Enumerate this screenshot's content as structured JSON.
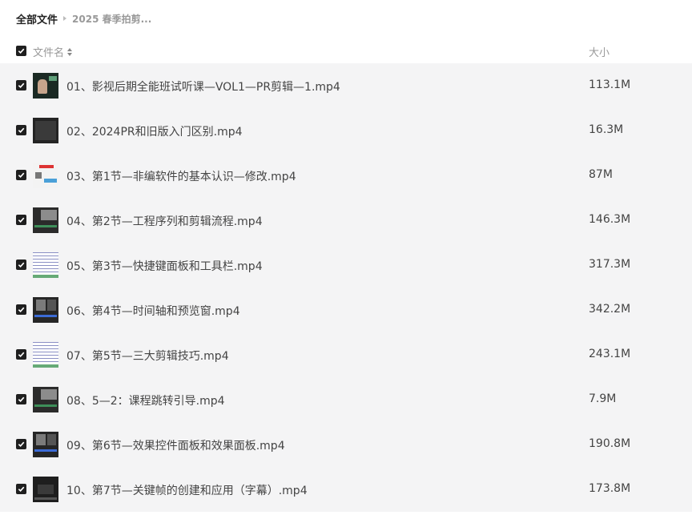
{
  "breadcrumb": {
    "root": "全部文件",
    "current": "2025 春季拍剪..."
  },
  "header": {
    "name_label": "文件名",
    "size_label": "大小"
  },
  "files": [
    {
      "name": "01、影视后期全能班试听课—VOL1—PR剪辑—1.mp4",
      "size": "113.1M",
      "thumb": "person"
    },
    {
      "name": "02、2024PR和旧版入门区别.mp4",
      "size": "16.3M",
      "thumb": "dark"
    },
    {
      "name": "03、第1节—非编软件的基本认识—修改.mp4",
      "size": "87M",
      "thumb": "slide"
    },
    {
      "name": "04、第2节—工程序列和剪辑流程.mp4",
      "size": "146.3M",
      "thumb": "editor"
    },
    {
      "name": "05、第3节—快捷键面板和工具栏.mp4",
      "size": "317.3M",
      "thumb": "grid"
    },
    {
      "name": "06、第4节—时间轴和预览窗.mp4",
      "size": "342.2M",
      "thumb": "editor2"
    },
    {
      "name": "07、第5节—三大剪辑技巧.mp4",
      "size": "243.1M",
      "thumb": "grid"
    },
    {
      "name": "08、5—2：课程跳转引导.mp4",
      "size": "7.9M",
      "thumb": "editor"
    },
    {
      "name": "09、第6节—效果控件面板和效果面板.mp4",
      "size": "190.8M",
      "thumb": "editor2"
    },
    {
      "name": "10、第7节—关键帧的创建和应用（字幕）.mp4",
      "size": "173.8M",
      "thumb": "dark2"
    }
  ]
}
